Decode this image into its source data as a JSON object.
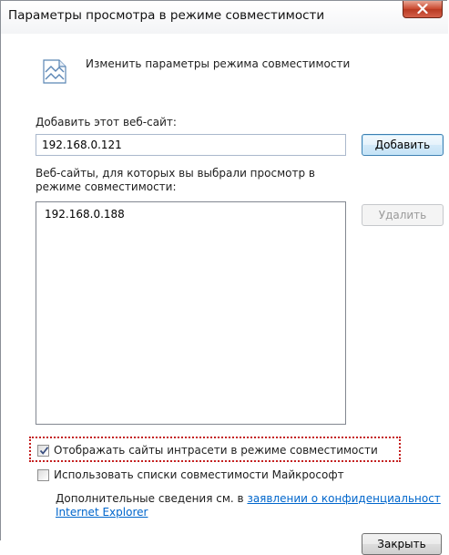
{
  "window": {
    "title": "Параметры просмотра в режиме совместимости"
  },
  "header": {
    "text": "Изменить параметры режима совместимости",
    "icon": "compatibility-view-icon"
  },
  "add_site": {
    "label": "Добавить этот веб-сайт:",
    "value": "192.168.0.121",
    "button": "Добавить"
  },
  "site_list": {
    "label": "Веб-сайты, для которых вы выбрали просмотр в режиме совместимости:",
    "items": [
      "192.168.0.188"
    ],
    "remove_button": "Удалить"
  },
  "options": {
    "intranet": {
      "label": "Отображать сайты интрасети в режиме совместимости",
      "checked": true
    },
    "microsoft_lists": {
      "label": "Использовать списки совместимости Майкрософт",
      "checked": false
    }
  },
  "info": {
    "prefix": "Дополнительные сведения см. в ",
    "link_line1": "заявлении о конфиденциальност",
    "link_line2": "Internet Explorer"
  },
  "footer": {
    "close_button": "Закрыть"
  },
  "colors": {
    "link": "#0066cc",
    "focus_rect": "#c42020",
    "close_button_red": "#c9462c"
  }
}
